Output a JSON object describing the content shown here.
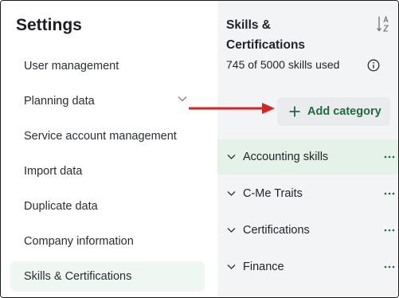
{
  "settings": {
    "title": "Settings",
    "nav": [
      {
        "label": "User management"
      },
      {
        "label": "Planning data"
      },
      {
        "label": "Service account management"
      },
      {
        "label": "Import data"
      },
      {
        "label": "Duplicate data"
      },
      {
        "label": "Company information"
      },
      {
        "label": "Skills & Certifications",
        "active": true
      }
    ]
  },
  "panel": {
    "title": "Skills & Certifications",
    "usage": "745 of 5000 skills used",
    "add_category_label": "Add category",
    "categories": [
      {
        "label": "Accounting skills",
        "active": true
      },
      {
        "label": "C-Me Traits"
      },
      {
        "label": "Certifications"
      },
      {
        "label": "Finance"
      }
    ]
  },
  "icons": {
    "sort": "sort-az-icon",
    "info": "info-icon",
    "plus": "plus-icon",
    "chevron": "chevron-down-icon",
    "more": "more-horizontal-icon"
  },
  "colors": {
    "accent_green": "#1f6b3e",
    "active_bg": "#e4f2e9",
    "annotation_red": "#e02020"
  }
}
